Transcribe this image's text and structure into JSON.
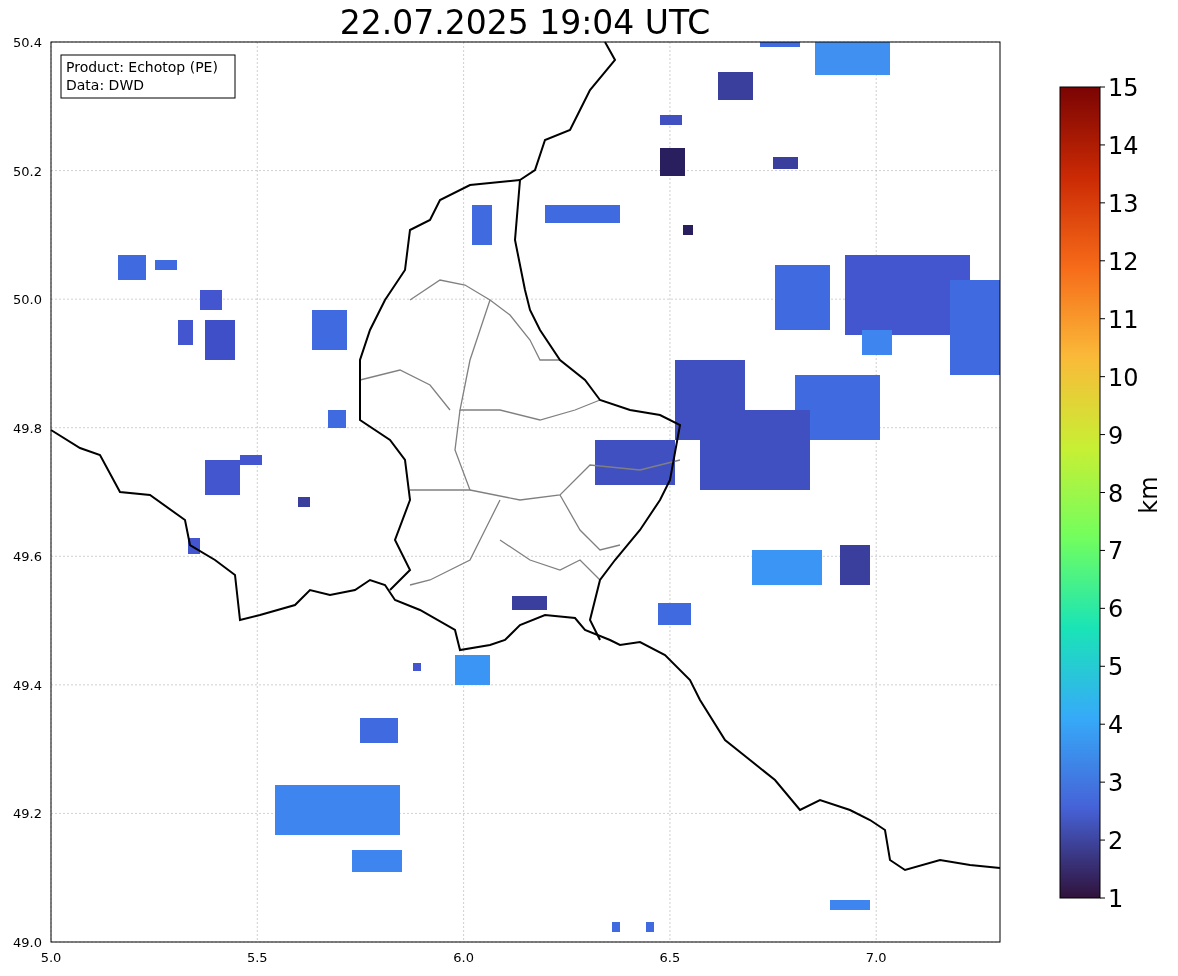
{
  "title": "22.07.2025 19:04 UTC",
  "info_box": {
    "lines": [
      "Product: Echotop (PE)",
      "Data: DWD"
    ]
  },
  "map": {
    "xticks": [
      "5.0",
      "5.5",
      "6.0",
      "6.5",
      "7.0"
    ],
    "yticks": [
      "50.4",
      "50.2",
      "50.0",
      "49.8",
      "49.6",
      "49.4",
      "49.2",
      "49.0"
    ]
  },
  "colorbar": {
    "label": "km",
    "ticks": [
      "15",
      "14",
      "13",
      "12",
      "11",
      "10",
      "9",
      "8",
      "7",
      "6",
      "5",
      "4",
      "3",
      "2",
      "1"
    ]
  }
}
